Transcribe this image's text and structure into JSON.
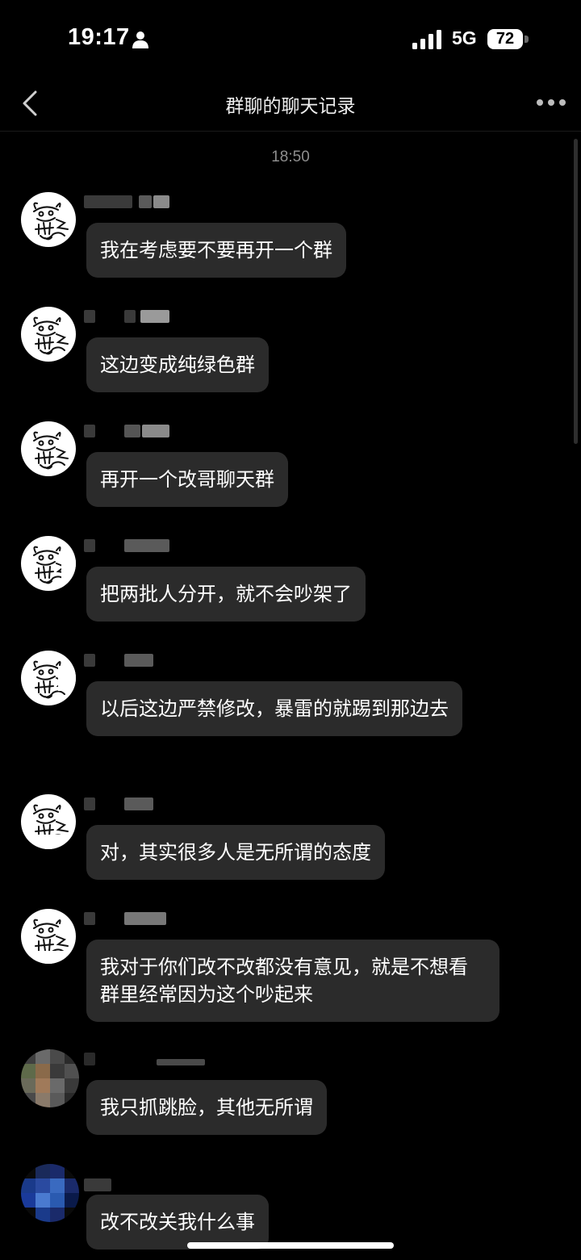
{
  "status_bar": {
    "time": "19:17",
    "network": "5G",
    "battery": "72"
  },
  "header": {
    "title": "群聊的聊天记录"
  },
  "chat": {
    "timestamp": "18:50",
    "messages": [
      {
        "text": "我在考虑要不要再开一个群"
      },
      {
        "text": "这边变成纯绿色群"
      },
      {
        "text": "再开一个改哥聊天群"
      },
      {
        "text": "把两批人分开，就不会吵架了"
      },
      {
        "text": "以后这边严禁修改，暴雷的就踢到那边去"
      },
      {
        "text": "对，其实很多人是无所谓的态度"
      },
      {
        "text": "我对于你们改不改都没有意见，就是不想看群里经常因为这个吵起来"
      },
      {
        "text": "我只抓跳脸，其他无所谓"
      },
      {
        "text": "改不改关我什么事"
      }
    ]
  },
  "colors": {
    "background": "#000000",
    "bubble": "#2b2b2b",
    "timestamp": "#8e8e8e",
    "text": "#ffffff"
  },
  "icons": {
    "back": "chevron-left-icon",
    "more": "more-horizontal-icon",
    "signal": "cellular-signal-icon",
    "person": "person-icon"
  }
}
